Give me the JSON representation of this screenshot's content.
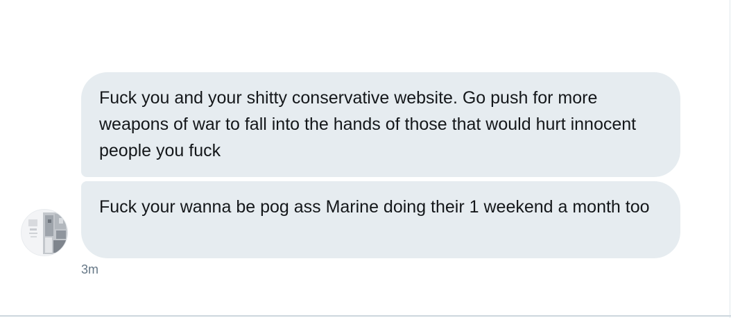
{
  "conversation": {
    "messages": [
      {
        "text": "Fuck you and your shitty conservative website. Go push for more weapons of war to fall into the hands of those that would hurt innocent people you fuck"
      },
      {
        "text": "Fuck your wanna be pog ass Marine doing their 1 weekend a month too"
      }
    ],
    "timestamp": "3m",
    "avatar_icon": "user-avatar-photo"
  },
  "colors": {
    "bubble": "#e6ecf0",
    "text": "#14171a",
    "timestamp": "#657786",
    "divider": "#ccd6dd"
  }
}
